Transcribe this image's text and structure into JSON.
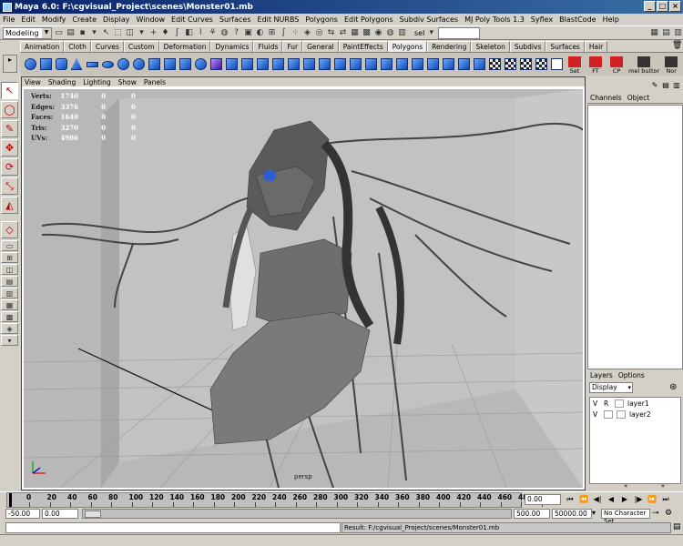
{
  "window": {
    "title": "Maya 6.0: F:\\cgvisual_Project\\scenes\\Monster01.mb"
  },
  "menus": [
    "File",
    "Edit",
    "Modify",
    "Create",
    "Display",
    "Window",
    "Edit Curves",
    "Surfaces",
    "Edit NURBS",
    "Polygons",
    "Edit Polygons",
    "Subdiv Surfaces",
    "MJ Poly Tools 1.3",
    "Syflex",
    "BlastCode",
    "Help"
  ],
  "status_line": {
    "mode": "Modeling",
    "sel_label": "sel",
    "sel_value": ""
  },
  "shelf_tabs": [
    "Animation",
    "Cloth",
    "Curves",
    "Custom",
    "Deformation",
    "Dynamics",
    "Fluids",
    "Fur",
    "General",
    "PaintEffects",
    "Polygons",
    "Rendering",
    "Skeleton",
    "Subdivs",
    "Surfaces",
    "Hair"
  ],
  "active_shelf_tab": "Polygons",
  "shelf_text_buttons": [
    "Set",
    "FT",
    "CP",
    "mel buttor",
    "Nor"
  ],
  "panel_menus": [
    "View",
    "Shading",
    "Lighting",
    "Show",
    "Panels"
  ],
  "hud": [
    {
      "label": "Verts:",
      "v1": "1740",
      "v2": "0",
      "v3": "0"
    },
    {
      "label": "Edges:",
      "v1": "3376",
      "v2": "0",
      "v3": "0"
    },
    {
      "label": "Faces:",
      "v1": "1640",
      "v2": "0",
      "v3": "0"
    },
    {
      "label": "Tris:",
      "v1": "3270",
      "v2": "0",
      "v3": "0"
    },
    {
      "label": "UVs:",
      "v1": "4986",
      "v2": "0",
      "v3": "0"
    }
  ],
  "camera_label": "persp",
  "channel_box": {
    "tabs": [
      "Channels",
      "Object"
    ]
  },
  "layers": {
    "tabs": [
      "Layers",
      "Options"
    ],
    "display_select": "Display",
    "items": [
      {
        "v": "V",
        "r": "R",
        "name": "layer1"
      },
      {
        "v": "V",
        "r": "",
        "name": "layer2"
      }
    ]
  },
  "time_slider": {
    "ticks": [
      "0",
      "20",
      "40",
      "60",
      "80",
      "100",
      "120",
      "140",
      "160",
      "180",
      "200",
      "220",
      "240",
      "260",
      "280",
      "300",
      "320",
      "340",
      "360",
      "380",
      "400",
      "420",
      "440",
      "460",
      "480",
      "5"
    ],
    "current_frame": "0.00"
  },
  "range_slider": {
    "start": "-50.00",
    "inner_start": "0.00",
    "inner_end": "500.00",
    "end": "50000.00",
    "character_set": "No Character Set"
  },
  "result_line": "Result: F:/cgvisual_Project/scenes/Monster01.mb",
  "colors": {
    "title_bar": "#0a246a",
    "viewport_bg": "#b4b4b4",
    "ui_gray": "#d4d0c8",
    "shelf_icon_blue": "#2f6fd6"
  }
}
